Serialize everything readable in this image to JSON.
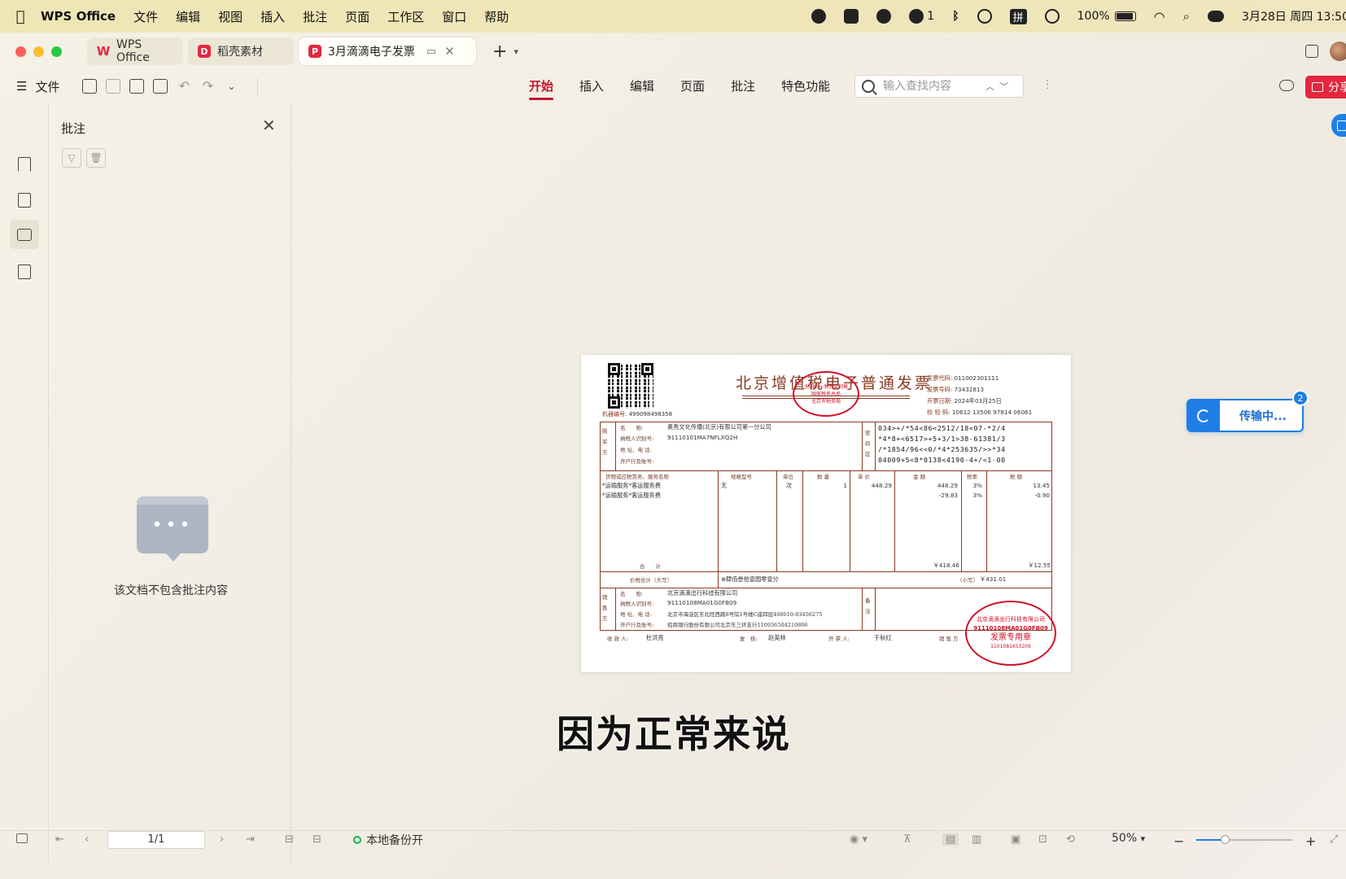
{
  "menubar": {
    "app_name": "WPS Office",
    "items": [
      "文件",
      "编辑",
      "视图",
      "插入",
      "批注",
      "页面",
      "工作区",
      "窗口",
      "帮助"
    ],
    "wechat_count": "1",
    "input_method": "拼",
    "battery": "100%",
    "datetime": "3月28日 周四 13:50"
  },
  "tabs": [
    {
      "label": "WPS Office",
      "active": false,
      "badge_color": "#e4263e"
    },
    {
      "label": "稻壳素材",
      "active": false,
      "badge_color": "#e4263e"
    },
    {
      "label": "3月滴滴电子发票",
      "active": true,
      "badge_color": "#e4263e"
    }
  ],
  "toolbar": {
    "file_label": "文件",
    "ribbon_tabs": [
      "开始",
      "插入",
      "编辑",
      "页面",
      "批注",
      "特色功能"
    ],
    "active_ribbon": "开始",
    "search_placeholder": "输入查找内容",
    "share_label": "分享"
  },
  "panel": {
    "title": "批注",
    "empty_text": "该文档不包含批注内容"
  },
  "invoice": {
    "title": "北京增值税电子普通发票",
    "top_seal_lines": [
      "全国统一发票监制章",
      "国家税务总局",
      "北京市税务局"
    ],
    "meta": [
      {
        "k": "发票代码:",
        "v": "011002301111"
      },
      {
        "k": "发票号码:",
        "v": "73432813"
      },
      {
        "k": "开票日期:",
        "v": "2024年03月25日"
      },
      {
        "k": "校 验 码:",
        "v": "10612 13506 97814 06061"
      }
    ],
    "machine_label": "机器编号:",
    "machine_no": "499098498358",
    "buyer": {
      "side_label": "购买方",
      "name_k": "名　　称:",
      "name": "奥秀文化传播(北京)有限公司第一分公司",
      "tax_k": "纳税人识别号:",
      "tax": "91110101MA7NFLXQ2H",
      "addr_k": "地 址、电 话:",
      "bank_k": "开户行及账号:"
    },
    "cipher_label": "密码区",
    "cipher": [
      "034>+/*54<86<2512/18<07-*2/4",
      "*4*8+<6517>+5+3/1>38-61381/3",
      "/*1854/96<<0/*4*253635/>>*34",
      "04009+5<8*0138<4190-4+/<1-00"
    ],
    "headers": [
      "货物或应税劳务、服务名称",
      "规格型号",
      "单位",
      "数 量",
      "单 价",
      "金 额",
      "税率",
      "税 额"
    ],
    "items": [
      {
        "name": "*运输服务*客运服务费",
        "spec": "无",
        "unit": "次",
        "qty": "1",
        "price": "448.29",
        "amount": "448.29",
        "rate": "3%",
        "tax": "13.45"
      },
      {
        "name": "*运输服务*客运服务费",
        "spec": "",
        "unit": "",
        "qty": "",
        "price": "",
        "amount": "-29.83",
        "rate": "3%",
        "tax": "-0.90"
      }
    ],
    "total_label": "合　　计",
    "total_amount": "￥418.46",
    "total_tax": "￥12.55",
    "grand_label": "价税合计（大写）",
    "grand_words": "⊗肆佰叁拾壹圆零壹分",
    "grand_small_label": "（小写）",
    "grand_small": "￥431.01",
    "seller": {
      "side_label": "销售方",
      "name_k": "名　　称:",
      "name": "北京滴滴出行科技有限公司",
      "tax_k": "纳税人识别号:",
      "tax": "91110108MA01G0FB09",
      "addr_k": "地 址、电 话:",
      "addr": "北京市海淀区东北旺西路8号院1号楼C座四层408010-83456275",
      "bank_k": "开户行及账号:",
      "bank": "招商银行股份有限公司北京东三环支行110936504210806"
    },
    "remark_label": "备注",
    "payee_k": "收 款 人:",
    "payee": "杜洪亮",
    "reviewer_k": "复　核:",
    "reviewer": "赵英林",
    "drawer_k": "开 票 人:",
    "drawer": "于秋红",
    "seller_sign_k": "销 售 方",
    "bottom_seal_lines": [
      "北京滴滴出行科技有限公司",
      "91110108MA01G0FB09",
      "发票专用章",
      "1101081653209"
    ]
  },
  "subtitle": "因为正常来说",
  "transfer": {
    "label": "传输中...",
    "count": "2"
  },
  "statusbar": {
    "page": "1/1",
    "backup_label": "本地备份开",
    "zoom": "50%",
    "zoom_fraction": 0.3
  }
}
